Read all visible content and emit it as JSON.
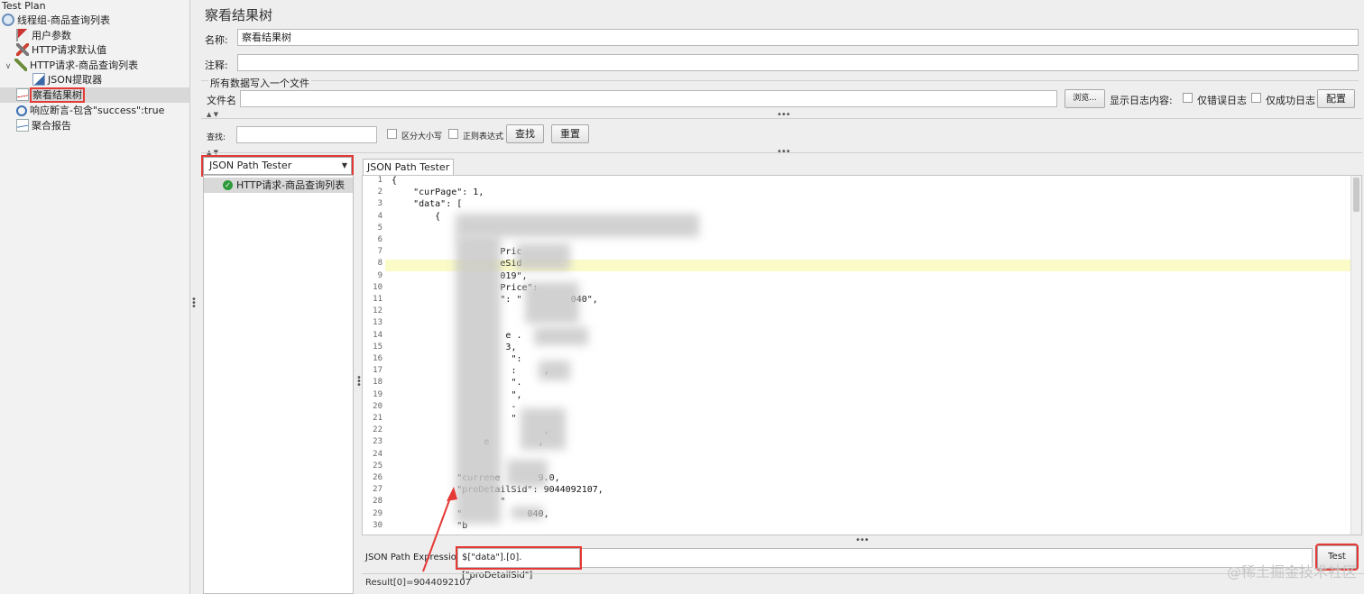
{
  "tree": {
    "items": [
      {
        "label": "Test Plan",
        "icon": "test-plan-icon"
      },
      {
        "label": "线程组-商品查询列表",
        "icon": "thread-group-icon"
      },
      {
        "label": "用户参数",
        "icon": "user-parameters-icon"
      },
      {
        "label": "HTTP请求默认值",
        "icon": "http-defaults-icon"
      },
      {
        "label": "HTTP请求-商品查询列表",
        "icon": "http-sampler-icon"
      },
      {
        "label": "JSON提取器",
        "icon": "json-extractor-icon"
      },
      {
        "label": "察看结果树",
        "icon": "view-results-tree-icon"
      },
      {
        "label": "响应断言-包含\"success\":true",
        "icon": "response-assertion-icon"
      },
      {
        "label": "聚合报告",
        "icon": "aggregate-report-icon"
      }
    ]
  },
  "panel": {
    "title": "察看结果树",
    "name_label": "名称:",
    "name_value": "察看结果树",
    "comment_label": "注释:",
    "comment_value": "",
    "file_section": "所有数据写入一个文件",
    "filename_label": "文件名",
    "filename_value": "",
    "browse_label": "浏览...",
    "log_label": "显示日志内容:",
    "errors_only_label": "仅错误日志",
    "success_only_label": "仅成功日志",
    "configure_label": "配置"
  },
  "search": {
    "label": "查找:",
    "value": "",
    "case_label": "区分大小写",
    "regex_label": "正则表达式",
    "find_label": "查找",
    "reset_label": "重置"
  },
  "renderer": {
    "selected": "JSON Path Tester",
    "result_item": "HTTP请求-商品查询列表"
  },
  "tester": {
    "tab_label": "JSON Path Tester",
    "lines": [
      {
        "n": "1",
        "text": "{"
      },
      {
        "n": "2",
        "text": "    \"curPage\": 1,"
      },
      {
        "n": "3",
        "text": "    \"data\": ["
      },
      {
        "n": "4",
        "text": "        {"
      },
      {
        "n": "5",
        "text": ""
      },
      {
        "n": "6",
        "text": ""
      },
      {
        "n": "7",
        "text": "                    Pric"
      },
      {
        "n": "8",
        "text": "                    eSid"
      },
      {
        "n": "9",
        "text": "                    019\","
      },
      {
        "n": "10",
        "text": "                    Price\":"
      },
      {
        "n": "11",
        "text": "                    \": \"         040\","
      },
      {
        "n": "12",
        "text": ""
      },
      {
        "n": "13",
        "text": ""
      },
      {
        "n": "14",
        "text": "                     e ."
      },
      {
        "n": "15",
        "text": "                     3,"
      },
      {
        "n": "16",
        "text": "                      \":"
      },
      {
        "n": "17",
        "text": "                      :     ,"
      },
      {
        "n": "18",
        "text": "                      \"."
      },
      {
        "n": "19",
        "text": "                      \","
      },
      {
        "n": "20",
        "text": "                      -"
      },
      {
        "n": "21",
        "text": "                      \""
      },
      {
        "n": "22",
        "text": "                            ,"
      },
      {
        "n": "23",
        "text": "                 e         ,"
      },
      {
        "n": "24",
        "text": ""
      },
      {
        "n": "25",
        "text": ""
      },
      {
        "n": "26",
        "text": "            \"currene       9.0,"
      },
      {
        "n": "27",
        "text": "            \"proDetailSid\": 9044092107,"
      },
      {
        "n": "28",
        "text": "                    \""
      },
      {
        "n": "29",
        "text": "            \"            040,"
      },
      {
        "n": "30",
        "text": "            \"b"
      }
    ],
    "expr_label": "JSON Path Expression",
    "expr_value": "$[\"data\"].[0].[\"proDetailSid\"]",
    "test_label": "Test",
    "result_text": "Result[0]=9044092107"
  },
  "watermark": "@稀土掘金技术社区",
  "colors": {
    "annotation_red": "#e53935",
    "highlight_line": "#fbfbc8",
    "success_green": "#2e9a3a"
  }
}
